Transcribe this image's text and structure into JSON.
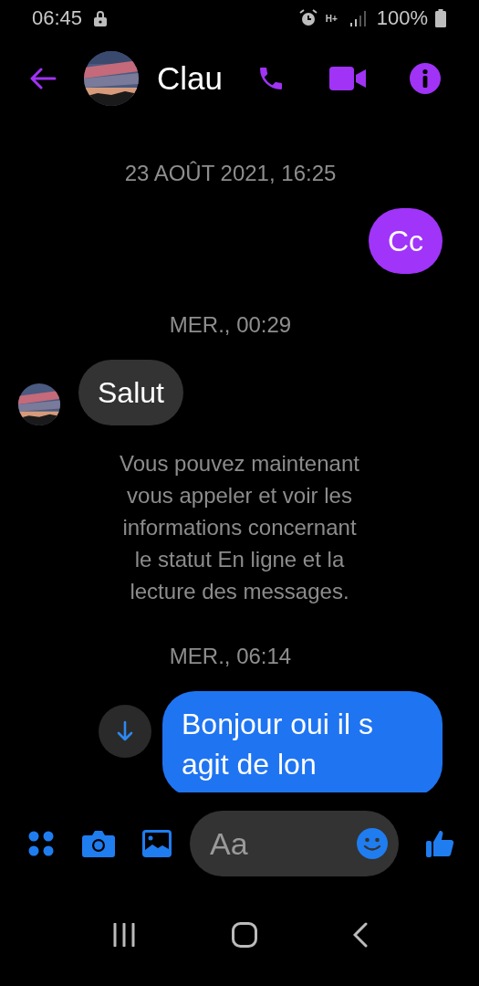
{
  "status_bar": {
    "time": "06:45",
    "network": "H+",
    "battery": "100%"
  },
  "header": {
    "contact_name": "Clau"
  },
  "messages": [
    {
      "kind": "timestamp",
      "text": "23 AOÛT 2021, 16:25"
    },
    {
      "kind": "sent",
      "text": "Cc",
      "color": "#a034f8"
    },
    {
      "kind": "timestamp",
      "text": "MER., 00:29"
    },
    {
      "kind": "received",
      "text": "Salut"
    },
    {
      "kind": "notice",
      "text": "Vous pouvez maintenant vous appeler et voir les informations concernant le statut En ligne et la lecture des messages."
    },
    {
      "kind": "timestamp",
      "text": "MER., 06:14"
    },
    {
      "kind": "sent",
      "text": "Bonjour oui il s agit de lon",
      "color": "#1f74f2"
    }
  ],
  "composer": {
    "placeholder": "Aa"
  }
}
